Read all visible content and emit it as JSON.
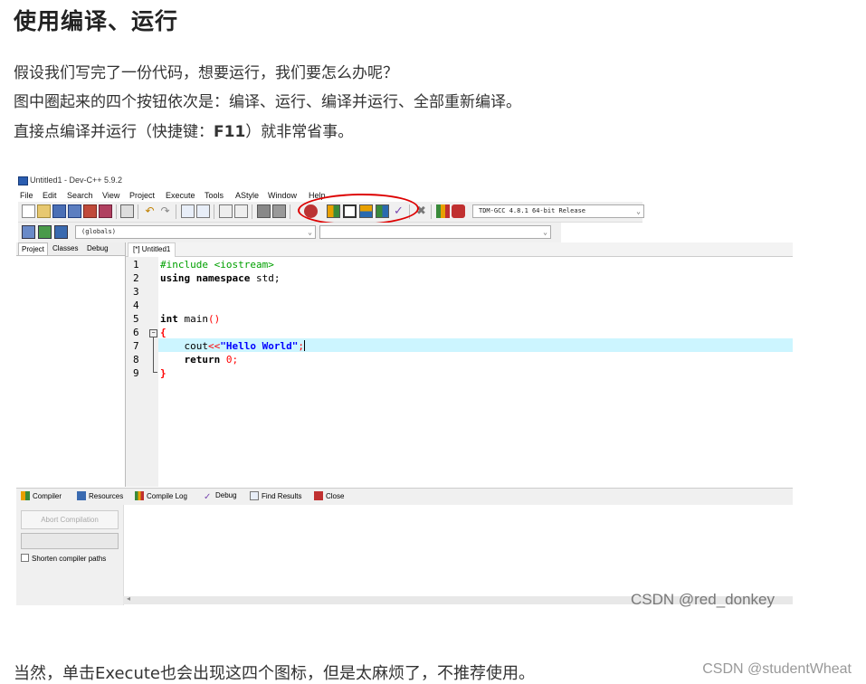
{
  "heading": "使用编译、运行",
  "paragraphs": {
    "p1": "假设我们写完了一份代码，想要运行，我们要怎么办呢？",
    "p2": "图中圈起来的四个按钮依次是：编译、运行、编译并运行、全部重新编译。",
    "p3_a": "直接点编译并运行（快捷键：",
    "p3_bold": "F11",
    "p3_b": "）就非常省事。"
  },
  "footer_text": "当然，单击Execute也会出现这四个图标，但是太麻烦了，不推荐使用。",
  "page_watermark": "CSDN @studentWheat",
  "ide": {
    "title": "Untitled1 - Dev-C++ 5.9.2",
    "menu": [
      "File",
      "Edit",
      "Search",
      "View",
      "Project",
      "Execute",
      "Tools",
      "AStyle",
      "Window",
      "Help"
    ],
    "compiler_select": "TDM-GCC 4.8.1 64-bit Release",
    "scope_select": "(globals)",
    "panel_tabs": [
      "Project",
      "Classes",
      "Debug"
    ],
    "editor_tab": "[*] Untitled1",
    "line_numbers": [
      "1",
      "2",
      "3",
      "4",
      "5",
      "6",
      "7",
      "8",
      "9"
    ],
    "code": {
      "l1": "#include <iostream>",
      "l2_kw": "using namespace",
      "l2_rest": " std;",
      "l5_kw": "int",
      "l5_rest": " main",
      "l5_paren": "()",
      "l6": "{",
      "l7_a": "    cout",
      "l7_op": "<<",
      "l7_str": "\"Hello World\"",
      "l7_end": ";",
      "l8_kw": "    return",
      "l8_num": " 0",
      "l8_end": ";",
      "l9": "}"
    },
    "bottom_tabs": [
      "Compiler",
      "Resources",
      "Compile Log",
      "Debug",
      "Find Results",
      "Close"
    ],
    "abort_label": "Abort Compilation",
    "shorten_label": "Shorten compiler paths",
    "watermark": "CSDN @red_donkey"
  },
  "colors": {
    "highlight_line": "#ccf5ff",
    "annotation_circle": "#dd0000"
  }
}
